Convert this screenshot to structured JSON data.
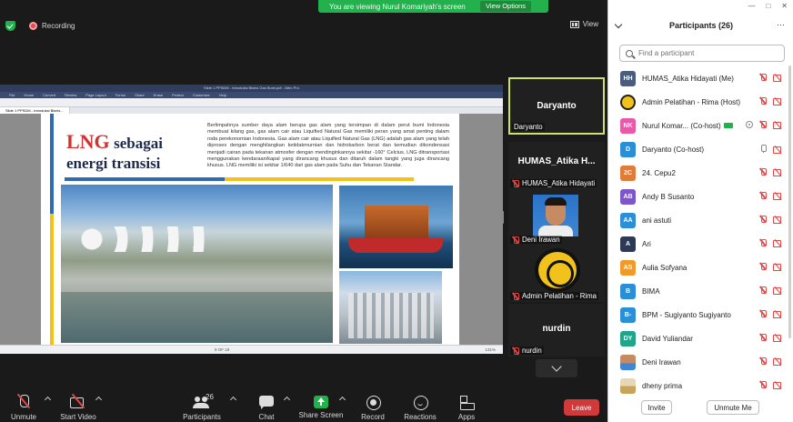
{
  "banner": {
    "text": "You are viewing Nurul Komariyah's screen",
    "options_label": "View Options"
  },
  "recording": {
    "label": "Recording"
  },
  "view_label": "View",
  "shared_doc": {
    "app_title": "Slide 1 PPSDM - Introduksi Bisnis Gas Bumi.pdf - Nitro Pro",
    "menu": [
      "File",
      "Home",
      "Convert",
      "Review",
      "Page Layout",
      "Forms",
      "Share",
      "Erase",
      "Protect",
      "Customize",
      "Help"
    ],
    "tab": "Slide 1 PPSDM - Introduksi Bisnis...",
    "slide_title_big": "LNG",
    "slide_title_rest": "sebagai",
    "slide_title_line2": "energi transisi",
    "slide_body": "Berlimpahnya sumber daya alam berupa gas alam yang tersimpan di dalam perut bumi Indonesia membuat kilang gas, gas alam cair atau Liquified Natural Gas memiliki peran yang amat penting dalam roda perekonomian Indonesia. Gas alam cair atau Liquified Natural Gas (LNG) adalah gas alam yang telah diproses dengan menghilangkan ketidakmurnian dan hidrokarbon berat dan kemudian dikondensasi menjadi cairan pada tekanan atmosfer dengan mendinginkannya sekitar -160° Celcius. LNG ditransportasi menggunakan kendaraan/kapal yang dirancang khusus dan ditaruh dalam tangki yang juga dirancang khusus. LNG memiliki isi sekitar 1/640 dari gas alam pada Suhu dan Tekanan Standar.",
    "page_indicator": "9 OF 19",
    "zoom": "131%"
  },
  "tiles": [
    {
      "display": "Daryanto",
      "label": "Daryanto",
      "muted": false
    },
    {
      "display": "HUMAS_Atika H...",
      "label": "HUMAS_Atika Hidayati",
      "muted": true
    },
    {
      "display": "",
      "label": "Deni Irawan",
      "muted": true
    },
    {
      "display": "",
      "label": "Admin Pelatihan - Rima",
      "muted": true
    },
    {
      "display": "nurdin",
      "label": "nurdin",
      "muted": true
    }
  ],
  "toolbar": {
    "unmute": "Unmute",
    "start_video": "Start Video",
    "participants": "Participants",
    "participants_count": "26",
    "chat": "Chat",
    "share_screen": "Share Screen",
    "record": "Record",
    "reactions": "Reactions",
    "apps": "Apps",
    "leave": "Leave"
  },
  "panel": {
    "title": "Participants (26)",
    "search_placeholder": "Find a participant",
    "invite": "Invite",
    "unmute_me": "Unmute Me",
    "participants": [
      {
        "initials": "HH",
        "name": "HUMAS_Atika Hidayati (Me)",
        "color": "#4a5d7e"
      },
      {
        "initials": "",
        "name": "Admin Pelatihan - Rima (Host)",
        "color": "#f0c21b"
      },
      {
        "initials": "NK",
        "name": "Nurul Komar... (Co-host)",
        "color": "#e85aa8"
      },
      {
        "initials": "D",
        "name": "Daryanto (Co-host)",
        "color": "#2b8fd8"
      },
      {
        "initials": "2C",
        "name": "24. Cepu2",
        "color": "#e07b39"
      },
      {
        "initials": "AB",
        "name": "Andy B Susanto",
        "color": "#7b57c9"
      },
      {
        "initials": "AA",
        "name": "ani astuti",
        "color": "#2b8fd8"
      },
      {
        "initials": "A",
        "name": "Ari",
        "color": "#2d3a56"
      },
      {
        "initials": "AS",
        "name": "Aulia Sofyana",
        "color": "#f09a2b"
      },
      {
        "initials": "B",
        "name": "BIMA",
        "color": "#2b8fd8"
      },
      {
        "initials": "B-",
        "name": "BPM - Sugiyanto Sugiyanto",
        "color": "#2b8fd8"
      },
      {
        "initials": "DY",
        "name": "David Yuliandar",
        "color": "#1fa58a"
      },
      {
        "initials": "",
        "name": "Deni Irawan",
        "color": "#3f86d3"
      },
      {
        "initials": "",
        "name": "dheny prima",
        "color": "#c9a25c"
      }
    ]
  }
}
